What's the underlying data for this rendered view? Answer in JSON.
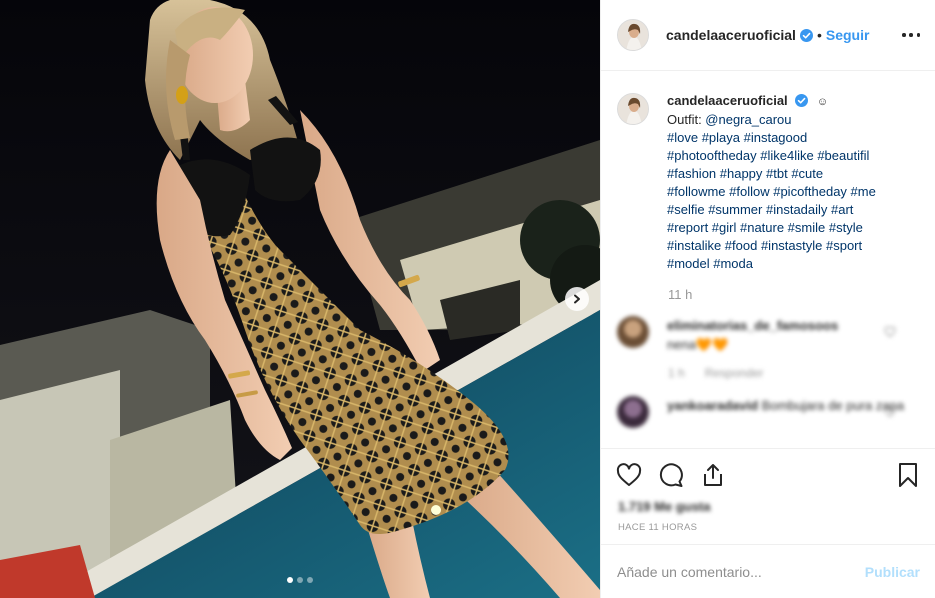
{
  "post": {
    "username": "candelaaceruoficial",
    "follow_label": "Seguir",
    "bullet": "•",
    "caption": {
      "emoji": "☺",
      "outfit_prefix": "Outfit: ",
      "outfit_mention": "@negra_carou",
      "hashtag_lines": [
        "#love #playa #instagood",
        "#photooftheday #like4like #beautifil",
        "#fashion #happy #tbt #cute",
        "#followme #follow #picoftheday #me",
        "#selfie #summer #instadaily #art",
        "#report #girl #nature #smile #style",
        "#instalike #food #instastyle #sport",
        "#model #moda"
      ]
    },
    "time_ago": "11 h",
    "comments": [
      {
        "username": "eliminatorias_de_famosoos",
        "text": "nena🧡🧡",
        "meta_time": "1 h",
        "meta_reply": "Responder"
      },
      {
        "username": "yankoaradavid",
        "text": "Bombujara de pura zapa",
        "meta_time": "",
        "meta_reply": ""
      }
    ],
    "likes": "1.719 Me gusta",
    "timestamp": "HACE 11 HORAS",
    "add_comment_placeholder": "Añade un comentario...",
    "publish_label": "Publicar"
  },
  "carousel": {
    "total": 3,
    "active": 1
  },
  "colors": {
    "link": "#3897f0",
    "hashtag": "#003569",
    "muted": "#999999",
    "publish_disabled": "#b2dffc",
    "border": "#efefef"
  }
}
